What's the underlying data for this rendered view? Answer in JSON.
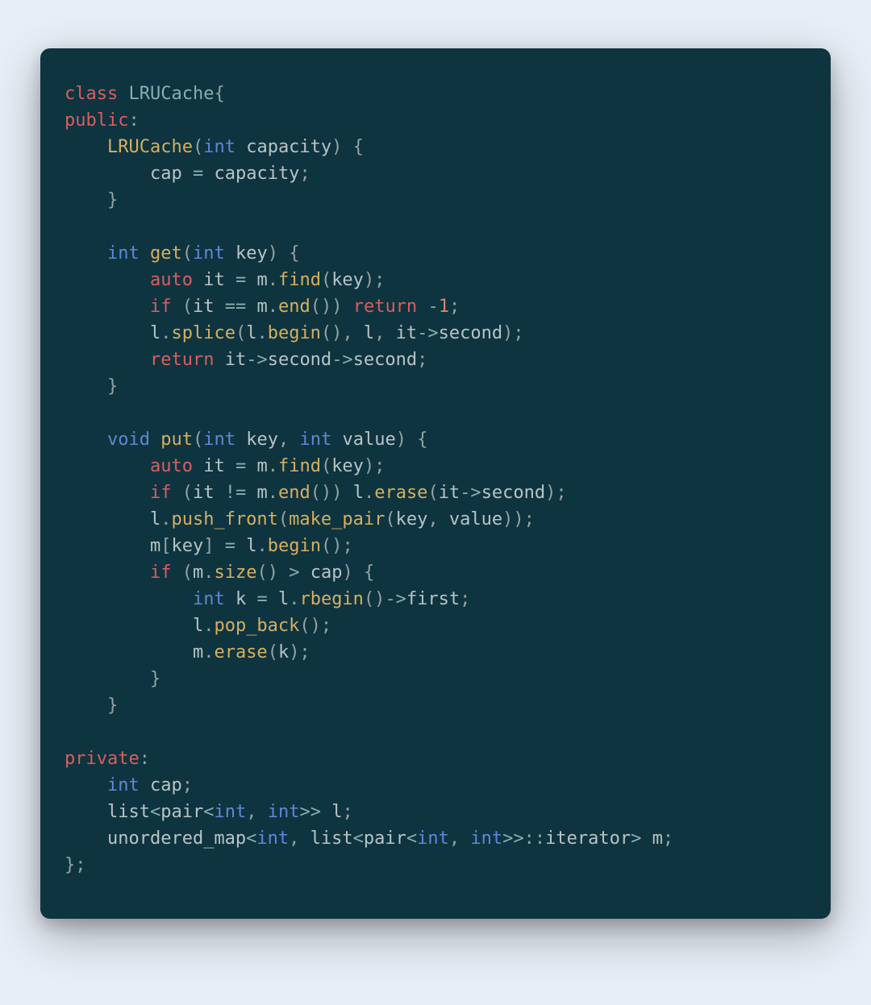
{
  "colors": {
    "bg_page": "#e8eef7",
    "bg_code": "#0e3440",
    "kw_red": "#d75f5f",
    "kw_blue": "#5f87d7",
    "type": "#87afaf",
    "fn": "#d7af5f",
    "id": "#b8c4c4",
    "punc": "#94a3a3",
    "op": "#87afaf",
    "num": "#d7875f"
  },
  "code": {
    "language": "cpp",
    "tokens": [
      [
        {
          "c": "kw-red",
          "t": "class"
        },
        {
          "c": "punc",
          "t": " "
        },
        {
          "c": "type",
          "t": "LRUCache"
        },
        {
          "c": "punc",
          "t": "{"
        }
      ],
      [
        {
          "c": "kw-red",
          "t": "public"
        },
        {
          "c": "punc",
          "t": ":"
        }
      ],
      [
        {
          "c": "punc",
          "t": "    "
        },
        {
          "c": "fn",
          "t": "LRUCache"
        },
        {
          "c": "punc",
          "t": "("
        },
        {
          "c": "kw-blue",
          "t": "int"
        },
        {
          "c": "punc",
          "t": " "
        },
        {
          "c": "id",
          "t": "capacity"
        },
        {
          "c": "punc",
          "t": ") {"
        }
      ],
      [
        {
          "c": "punc",
          "t": "        "
        },
        {
          "c": "id",
          "t": "cap"
        },
        {
          "c": "punc",
          "t": " "
        },
        {
          "c": "op",
          "t": "="
        },
        {
          "c": "punc",
          "t": " "
        },
        {
          "c": "id",
          "t": "capacity"
        },
        {
          "c": "punc",
          "t": ";"
        }
      ],
      [
        {
          "c": "punc",
          "t": "    }"
        }
      ],
      [],
      [
        {
          "c": "punc",
          "t": "    "
        },
        {
          "c": "kw-blue",
          "t": "int"
        },
        {
          "c": "punc",
          "t": " "
        },
        {
          "c": "fn",
          "t": "get"
        },
        {
          "c": "punc",
          "t": "("
        },
        {
          "c": "kw-blue",
          "t": "int"
        },
        {
          "c": "punc",
          "t": " "
        },
        {
          "c": "id",
          "t": "key"
        },
        {
          "c": "punc",
          "t": ") {"
        }
      ],
      [
        {
          "c": "punc",
          "t": "        "
        },
        {
          "c": "kw-red",
          "t": "auto"
        },
        {
          "c": "punc",
          "t": " "
        },
        {
          "c": "id",
          "t": "it"
        },
        {
          "c": "punc",
          "t": " "
        },
        {
          "c": "op",
          "t": "="
        },
        {
          "c": "punc",
          "t": " "
        },
        {
          "c": "id",
          "t": "m"
        },
        {
          "c": "punc",
          "t": "."
        },
        {
          "c": "fn",
          "t": "find"
        },
        {
          "c": "punc",
          "t": "("
        },
        {
          "c": "id",
          "t": "key"
        },
        {
          "c": "punc",
          "t": ");"
        }
      ],
      [
        {
          "c": "punc",
          "t": "        "
        },
        {
          "c": "kw-red",
          "t": "if"
        },
        {
          "c": "punc",
          "t": " ("
        },
        {
          "c": "id",
          "t": "it"
        },
        {
          "c": "punc",
          "t": " "
        },
        {
          "c": "op",
          "t": "=="
        },
        {
          "c": "punc",
          "t": " "
        },
        {
          "c": "id",
          "t": "m"
        },
        {
          "c": "punc",
          "t": "."
        },
        {
          "c": "fn",
          "t": "end"
        },
        {
          "c": "punc",
          "t": "()) "
        },
        {
          "c": "kw-red",
          "t": "return"
        },
        {
          "c": "punc",
          "t": " "
        },
        {
          "c": "op",
          "t": "-"
        },
        {
          "c": "num",
          "t": "1"
        },
        {
          "c": "punc",
          "t": ";"
        }
      ],
      [
        {
          "c": "punc",
          "t": "        "
        },
        {
          "c": "id",
          "t": "l"
        },
        {
          "c": "punc",
          "t": "."
        },
        {
          "c": "fn",
          "t": "splice"
        },
        {
          "c": "punc",
          "t": "("
        },
        {
          "c": "id",
          "t": "l"
        },
        {
          "c": "punc",
          "t": "."
        },
        {
          "c": "fn",
          "t": "begin"
        },
        {
          "c": "punc",
          "t": "(), "
        },
        {
          "c": "id",
          "t": "l"
        },
        {
          "c": "punc",
          "t": ", "
        },
        {
          "c": "id",
          "t": "it"
        },
        {
          "c": "op",
          "t": "->"
        },
        {
          "c": "id",
          "t": "second"
        },
        {
          "c": "punc",
          "t": ");"
        }
      ],
      [
        {
          "c": "punc",
          "t": "        "
        },
        {
          "c": "kw-red",
          "t": "return"
        },
        {
          "c": "punc",
          "t": " "
        },
        {
          "c": "id",
          "t": "it"
        },
        {
          "c": "op",
          "t": "->"
        },
        {
          "c": "id",
          "t": "second"
        },
        {
          "c": "op",
          "t": "->"
        },
        {
          "c": "id",
          "t": "second"
        },
        {
          "c": "punc",
          "t": ";"
        }
      ],
      [
        {
          "c": "punc",
          "t": "    }"
        }
      ],
      [],
      [
        {
          "c": "punc",
          "t": "    "
        },
        {
          "c": "kw-blue",
          "t": "void"
        },
        {
          "c": "punc",
          "t": " "
        },
        {
          "c": "fn",
          "t": "put"
        },
        {
          "c": "punc",
          "t": "("
        },
        {
          "c": "kw-blue",
          "t": "int"
        },
        {
          "c": "punc",
          "t": " "
        },
        {
          "c": "id",
          "t": "key"
        },
        {
          "c": "punc",
          "t": ", "
        },
        {
          "c": "kw-blue",
          "t": "int"
        },
        {
          "c": "punc",
          "t": " "
        },
        {
          "c": "id",
          "t": "value"
        },
        {
          "c": "punc",
          "t": ") {"
        }
      ],
      [
        {
          "c": "punc",
          "t": "        "
        },
        {
          "c": "kw-red",
          "t": "auto"
        },
        {
          "c": "punc",
          "t": " "
        },
        {
          "c": "id",
          "t": "it"
        },
        {
          "c": "punc",
          "t": " "
        },
        {
          "c": "op",
          "t": "="
        },
        {
          "c": "punc",
          "t": " "
        },
        {
          "c": "id",
          "t": "m"
        },
        {
          "c": "punc",
          "t": "."
        },
        {
          "c": "fn",
          "t": "find"
        },
        {
          "c": "punc",
          "t": "("
        },
        {
          "c": "id",
          "t": "key"
        },
        {
          "c": "punc",
          "t": ");"
        }
      ],
      [
        {
          "c": "punc",
          "t": "        "
        },
        {
          "c": "kw-red",
          "t": "if"
        },
        {
          "c": "punc",
          "t": " ("
        },
        {
          "c": "id",
          "t": "it"
        },
        {
          "c": "punc",
          "t": " "
        },
        {
          "c": "op",
          "t": "!="
        },
        {
          "c": "punc",
          "t": " "
        },
        {
          "c": "id",
          "t": "m"
        },
        {
          "c": "punc",
          "t": "."
        },
        {
          "c": "fn",
          "t": "end"
        },
        {
          "c": "punc",
          "t": "()) "
        },
        {
          "c": "id",
          "t": "l"
        },
        {
          "c": "punc",
          "t": "."
        },
        {
          "c": "fn",
          "t": "erase"
        },
        {
          "c": "punc",
          "t": "("
        },
        {
          "c": "id",
          "t": "it"
        },
        {
          "c": "op",
          "t": "->"
        },
        {
          "c": "id",
          "t": "second"
        },
        {
          "c": "punc",
          "t": ");"
        }
      ],
      [
        {
          "c": "punc",
          "t": "        "
        },
        {
          "c": "id",
          "t": "l"
        },
        {
          "c": "punc",
          "t": "."
        },
        {
          "c": "fn",
          "t": "push_front"
        },
        {
          "c": "punc",
          "t": "("
        },
        {
          "c": "fn",
          "t": "make_pair"
        },
        {
          "c": "punc",
          "t": "("
        },
        {
          "c": "id",
          "t": "key"
        },
        {
          "c": "punc",
          "t": ", "
        },
        {
          "c": "id",
          "t": "value"
        },
        {
          "c": "punc",
          "t": "));"
        }
      ],
      [
        {
          "c": "punc",
          "t": "        "
        },
        {
          "c": "id",
          "t": "m"
        },
        {
          "c": "punc",
          "t": "["
        },
        {
          "c": "id",
          "t": "key"
        },
        {
          "c": "punc",
          "t": "] "
        },
        {
          "c": "op",
          "t": "="
        },
        {
          "c": "punc",
          "t": " "
        },
        {
          "c": "id",
          "t": "l"
        },
        {
          "c": "punc",
          "t": "."
        },
        {
          "c": "fn",
          "t": "begin"
        },
        {
          "c": "punc",
          "t": "();"
        }
      ],
      [
        {
          "c": "punc",
          "t": "        "
        },
        {
          "c": "kw-red",
          "t": "if"
        },
        {
          "c": "punc",
          "t": " ("
        },
        {
          "c": "id",
          "t": "m"
        },
        {
          "c": "punc",
          "t": "."
        },
        {
          "c": "fn",
          "t": "size"
        },
        {
          "c": "punc",
          "t": "() "
        },
        {
          "c": "op",
          "t": ">"
        },
        {
          "c": "punc",
          "t": " "
        },
        {
          "c": "id",
          "t": "cap"
        },
        {
          "c": "punc",
          "t": ") {"
        }
      ],
      [
        {
          "c": "punc",
          "t": "            "
        },
        {
          "c": "kw-blue",
          "t": "int"
        },
        {
          "c": "punc",
          "t": " "
        },
        {
          "c": "id",
          "t": "k"
        },
        {
          "c": "punc",
          "t": " "
        },
        {
          "c": "op",
          "t": "="
        },
        {
          "c": "punc",
          "t": " "
        },
        {
          "c": "id",
          "t": "l"
        },
        {
          "c": "punc",
          "t": "."
        },
        {
          "c": "fn",
          "t": "rbegin"
        },
        {
          "c": "punc",
          "t": "()"
        },
        {
          "c": "op",
          "t": "->"
        },
        {
          "c": "id",
          "t": "first"
        },
        {
          "c": "punc",
          "t": ";"
        }
      ],
      [
        {
          "c": "punc",
          "t": "            "
        },
        {
          "c": "id",
          "t": "l"
        },
        {
          "c": "punc",
          "t": "."
        },
        {
          "c": "fn",
          "t": "pop_back"
        },
        {
          "c": "punc",
          "t": "();"
        }
      ],
      [
        {
          "c": "punc",
          "t": "            "
        },
        {
          "c": "id",
          "t": "m"
        },
        {
          "c": "punc",
          "t": "."
        },
        {
          "c": "fn",
          "t": "erase"
        },
        {
          "c": "punc",
          "t": "("
        },
        {
          "c": "id",
          "t": "k"
        },
        {
          "c": "punc",
          "t": ");"
        }
      ],
      [
        {
          "c": "punc",
          "t": "        }"
        }
      ],
      [
        {
          "c": "punc",
          "t": "    }"
        }
      ],
      [],
      [
        {
          "c": "kw-red",
          "t": "private"
        },
        {
          "c": "punc",
          "t": ":"
        }
      ],
      [
        {
          "c": "punc",
          "t": "    "
        },
        {
          "c": "kw-blue",
          "t": "int"
        },
        {
          "c": "punc",
          "t": " "
        },
        {
          "c": "id",
          "t": "cap"
        },
        {
          "c": "punc",
          "t": ";"
        }
      ],
      [
        {
          "c": "punc",
          "t": "    "
        },
        {
          "c": "id",
          "t": "list"
        },
        {
          "c": "op",
          "t": "<"
        },
        {
          "c": "id",
          "t": "pair"
        },
        {
          "c": "op",
          "t": "<"
        },
        {
          "c": "kw-blue",
          "t": "int"
        },
        {
          "c": "punc",
          "t": ", "
        },
        {
          "c": "kw-blue",
          "t": "int"
        },
        {
          "c": "op",
          "t": ">>"
        },
        {
          "c": "punc",
          "t": " "
        },
        {
          "c": "id",
          "t": "l"
        },
        {
          "c": "punc",
          "t": ";"
        }
      ],
      [
        {
          "c": "punc",
          "t": "    "
        },
        {
          "c": "id",
          "t": "unordered_map"
        },
        {
          "c": "op",
          "t": "<"
        },
        {
          "c": "kw-blue",
          "t": "int"
        },
        {
          "c": "punc",
          "t": ", "
        },
        {
          "c": "id",
          "t": "list"
        },
        {
          "c": "op",
          "t": "<"
        },
        {
          "c": "id",
          "t": "pair"
        },
        {
          "c": "op",
          "t": "<"
        },
        {
          "c": "kw-blue",
          "t": "int"
        },
        {
          "c": "punc",
          "t": ", "
        },
        {
          "c": "kw-blue",
          "t": "int"
        },
        {
          "c": "op",
          "t": ">>::"
        },
        {
          "c": "id",
          "t": "iterator"
        },
        {
          "c": "op",
          "t": ">"
        },
        {
          "c": "punc",
          "t": " "
        },
        {
          "c": "id",
          "t": "m"
        },
        {
          "c": "punc",
          "t": ";"
        }
      ],
      [
        {
          "c": "punc",
          "t": "};"
        }
      ]
    ]
  }
}
